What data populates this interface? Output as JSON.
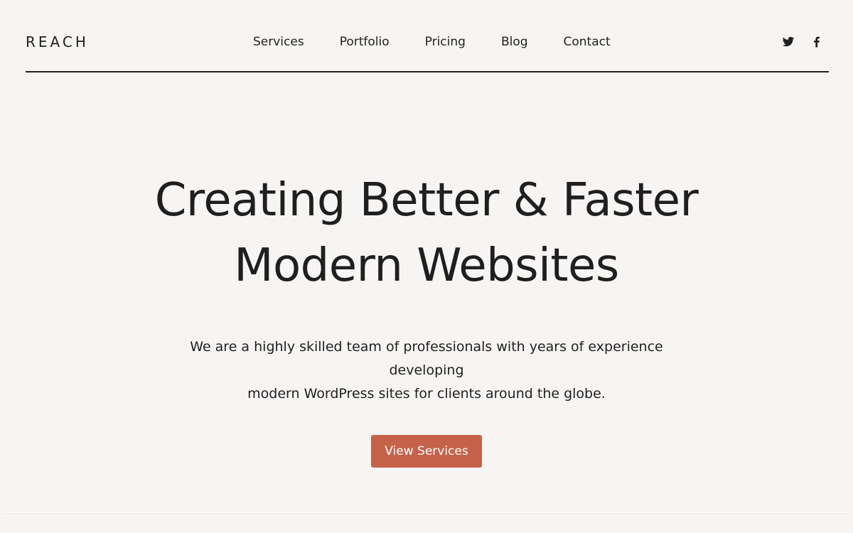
{
  "header": {
    "logo": "REACH",
    "nav": [
      {
        "label": "Services"
      },
      {
        "label": "Portfolio"
      },
      {
        "label": "Pricing"
      },
      {
        "label": "Blog"
      },
      {
        "label": "Contact"
      }
    ],
    "social": [
      {
        "icon": "twitter-icon"
      },
      {
        "icon": "facebook-icon"
      }
    ]
  },
  "hero": {
    "title_line1": "Creating Better & Faster",
    "title_line2": "Modern Websites",
    "description_line1": "We are a highly skilled team of professionals with years of experience developing",
    "description_line2": "modern WordPress sites for clients around the globe.",
    "cta_label": "View Services"
  },
  "colors": {
    "background": "#f7f5f3",
    "text": "#1f1f1f",
    "accent": "#c6624a"
  }
}
